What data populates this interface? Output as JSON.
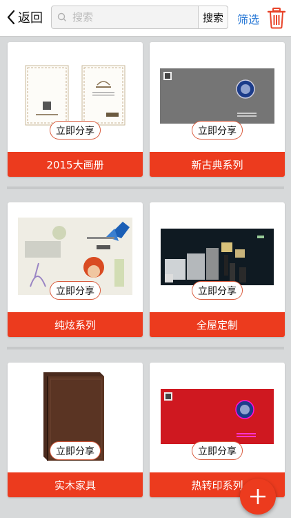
{
  "header": {
    "back_label": "返回",
    "search_placeholder": "搜索",
    "search_button": "搜索",
    "filter_label": "筛选"
  },
  "share_label": "立即分享",
  "albums": [
    {
      "title": "2015大画册",
      "thumb": "brochure-2015-icon"
    },
    {
      "title": "新古典系列",
      "thumb": "neo-classical-cover-icon"
    },
    {
      "title": "纯炫系列",
      "thumb": "butterfly-collage-icon"
    },
    {
      "title": "全屋定制",
      "thumb": "whole-house-custom-icon"
    },
    {
      "title": "实木家具",
      "thumb": "leather-book-icon"
    },
    {
      "title": "热转印系列",
      "thumb": "red-cover-icon"
    }
  ],
  "colors": {
    "accent": "#ec3b1e",
    "link": "#2979d6",
    "background": "#d7d9da"
  }
}
